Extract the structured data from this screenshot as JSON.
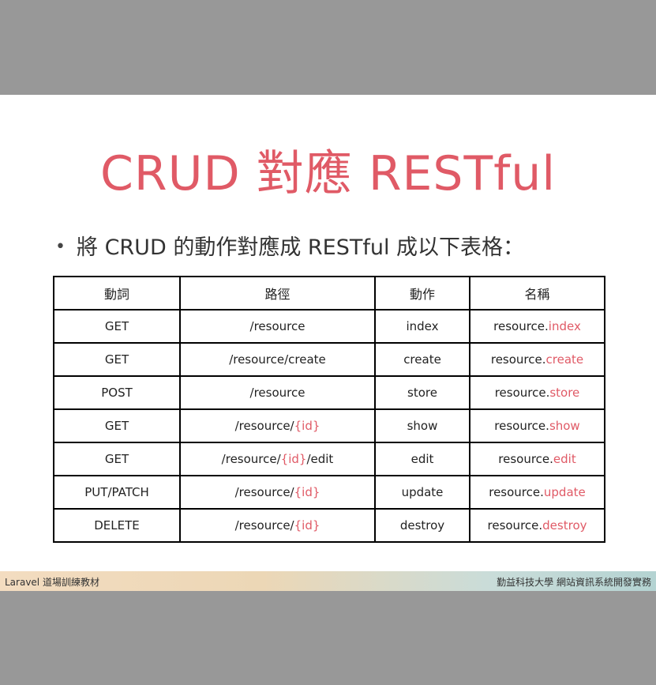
{
  "slide": {
    "title": "CRUD 對應 RESTful",
    "bullet": "將 CRUD 的動作對應成 RESTful 成以下表格："
  },
  "table": {
    "headers": [
      "動詞",
      "路徑",
      "動作",
      "名稱"
    ],
    "rows": [
      {
        "verb": "GET",
        "path_prefix": "/resource",
        "path_param": "",
        "path_suffix": "",
        "action": "index",
        "name_prefix": "resource.",
        "name_hl": "index"
      },
      {
        "verb": "GET",
        "path_prefix": "/resource/create",
        "path_param": "",
        "path_suffix": "",
        "action": "create",
        "name_prefix": "resource.",
        "name_hl": "create"
      },
      {
        "verb": "POST",
        "path_prefix": "/resource",
        "path_param": "",
        "path_suffix": "",
        "action": "store",
        "name_prefix": "resource.",
        "name_hl": "store"
      },
      {
        "verb": "GET",
        "path_prefix": "/resource/",
        "path_param": "{id}",
        "path_suffix": "",
        "action": "show",
        "name_prefix": "resource.",
        "name_hl": "show"
      },
      {
        "verb": "GET",
        "path_prefix": "/resource/",
        "path_param": "{id}",
        "path_suffix": "/edit",
        "action": "edit",
        "name_prefix": "resource.",
        "name_hl": "edit"
      },
      {
        "verb": "PUT/PATCH",
        "path_prefix": "/resource/",
        "path_param": "{id}",
        "path_suffix": "",
        "action": "update",
        "name_prefix": "resource.",
        "name_hl": "update"
      },
      {
        "verb": "DELETE",
        "path_prefix": "/resource/",
        "path_param": "{id}",
        "path_suffix": "",
        "action": "destroy",
        "name_prefix": "resource.",
        "name_hl": "destroy"
      }
    ]
  },
  "footer": {
    "left": "Laravel 道場訓練教材",
    "right": "勤益科技大學 網站資訊系統開發實務"
  },
  "colors": {
    "accent": "#e05a66",
    "outer_background": "#989898"
  }
}
